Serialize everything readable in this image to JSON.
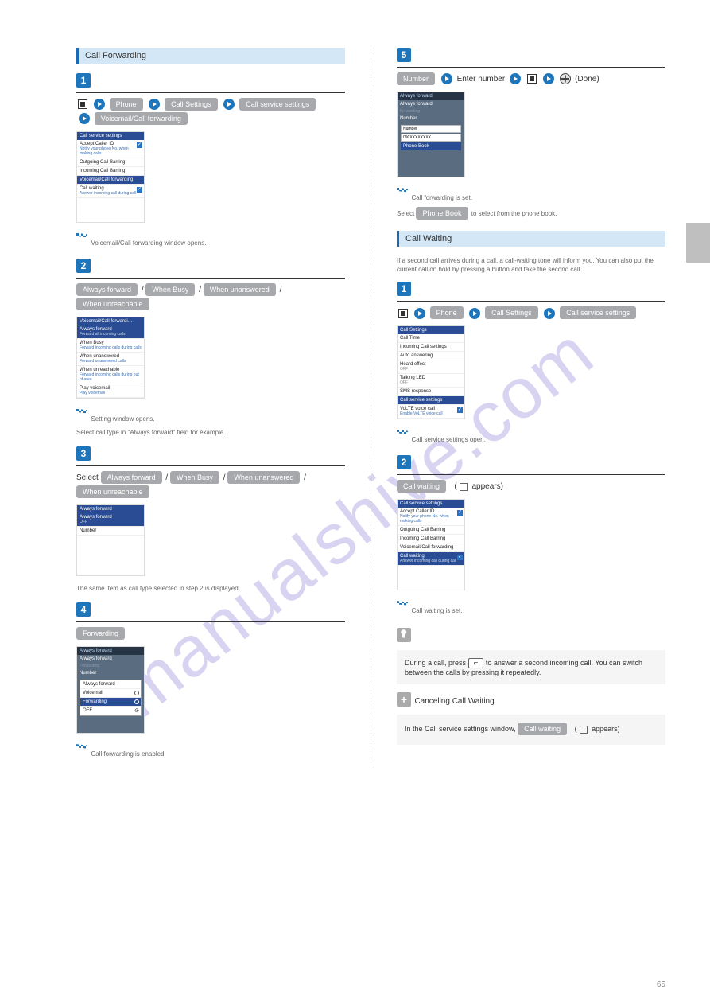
{
  "page_number": "65",
  "watermark": "manualshive.com",
  "left": {
    "section_title": "Call Forwarding",
    "step1": {
      "path": [
        "Phone",
        "Call Settings",
        "Call service settings",
        "Voicemail/Call forwarding"
      ],
      "screenshot": {
        "title": "Call service settings",
        "rows": [
          {
            "label": "Accept Caller ID",
            "sub": "Notify your phone No. when making calls",
            "checked": true
          },
          {
            "label": "Outgoing Call Barring"
          },
          {
            "label": "Incoming Call Barring"
          },
          {
            "label": "Voicemail/Call forwarding",
            "hl": true
          },
          {
            "label": "Call waiting",
            "sub": "Answer incoming call during call",
            "checked": true
          }
        ]
      },
      "flag_text": "Voicemail/Call forwarding window opens."
    },
    "step2": {
      "body_parts": [
        "Always forward",
        " / ",
        "When Busy",
        " / ",
        "When unanswered",
        " / ",
        "When unreachable"
      ],
      "screenshot": {
        "title": "Voicemail/Call forwardi…",
        "rows": [
          {
            "label": "Always forward",
            "sub": "Forward all incoming calls",
            "hl": true
          },
          {
            "label": "When Busy",
            "sub": "Forward incoming calls during calls"
          },
          {
            "label": "When unanswered",
            "sub": "Forward unanswered calls"
          },
          {
            "label": "When unreachable",
            "sub": "Forward incoming calls during out of area"
          },
          {
            "label": "Play voicemail",
            "sub": "Play voicemail"
          }
        ]
      },
      "flag_text": "Setting window opens.",
      "footnote": "Select call type in \"Always forward\" field for example."
    },
    "step3": {
      "line1_prefix": "Select ",
      "line1_parts": [
        "Always forward",
        " / ",
        "When Busy",
        " / ",
        "When unanswered",
        " / ",
        "When unreachable"
      ],
      "screenshot": {
        "title": "Always forward",
        "rows": [
          {
            "label": "Always forward",
            "sub": "OFF",
            "hl": true
          },
          {
            "label": "Number",
            "sub": " "
          }
        ]
      },
      "footnote": "The same item as call type selected in step 2 is displayed."
    },
    "step4": {
      "pill": "Forwarding",
      "screenshot": {
        "top_header": "Always forward",
        "dark_rows": [
          "Always forward",
          "Forwarding",
          "Number"
        ],
        "overlay": [
          {
            "label": "Always forward"
          },
          {
            "label": "Voicemail",
            "radio": true
          },
          {
            "label": "Forwarding",
            "hl": true,
            "radio_on": true
          },
          {
            "label": "OFF",
            "cancel": true
          }
        ]
      },
      "flag_text": "Call forwarding is enabled."
    }
  },
  "right": {
    "step5": {
      "line1_parts": [
        "Number",
        "  Enter number  ",
        "(Done)"
      ],
      "screenshot": {
        "top_header": "Always forward",
        "dark_rows_top": [
          "Always forward",
          "Forwarding"
        ],
        "number_label": "Number",
        "number_header": "Number",
        "number_value": "090XXXXXXXX",
        "phonebook": "Phone Book"
      },
      "flag_text": "Call forwarding is set.",
      "footnote_prefix": "Select ",
      "footnote_pill": "Phone Book",
      "footnote_suffix": " to select from the phone book."
    },
    "section_title": "Call Waiting",
    "section_sub": "If a second call arrives during a call, a call-waiting tone will inform you. You can also put the current call on hold by pressing a button and take the second call.",
    "step1b": {
      "path": [
        "Phone",
        "Call Settings",
        "Call service settings"
      ],
      "screenshot": {
        "title": "Call Settings",
        "rows": [
          {
            "label": "Call Time"
          },
          {
            "label": "Incoming Call settings"
          },
          {
            "label": "Auto answering"
          },
          {
            "label": "Heard effect",
            "sub": "OFF"
          },
          {
            "label": "Talking LED",
            "sub": "OFF"
          },
          {
            "label": "SMS response"
          },
          {
            "label": "Call service settings",
            "hl": true
          },
          {
            "label": "VoLTE voice call",
            "sub": "Enable VoLTE voice call",
            "checked": true
          }
        ]
      },
      "flag_text": "Call service settings open."
    },
    "step2b": {
      "pill": "Call waiting",
      "check_suffix": "( ☐ appears)",
      "screenshot": {
        "title": "Call service settings",
        "rows": [
          {
            "label": "Accept Caller ID",
            "sub": "Notify your phone No. when making calls",
            "checked": true
          },
          {
            "label": "Outgoing Call Barring"
          },
          {
            "label": "Incoming Call Barring"
          },
          {
            "label": "Voicemail/Call forwarding"
          },
          {
            "label": "Call waiting",
            "sub": "Answer incoming call during call",
            "hl": true,
            "checked": true
          }
        ]
      },
      "flag_text": "Call waiting is set."
    },
    "tip": {
      "text_prefix": "During a call, press ",
      "text_suffix": " to answer a second incoming call. You can switch between the calls by pressing it repeatedly."
    },
    "plus": {
      "title": "Canceling Call Waiting",
      "text_prefix": "In the Call service settings window, ",
      "pill": "Call waiting",
      "text_suffix": " ( ☐ appears)"
    }
  }
}
